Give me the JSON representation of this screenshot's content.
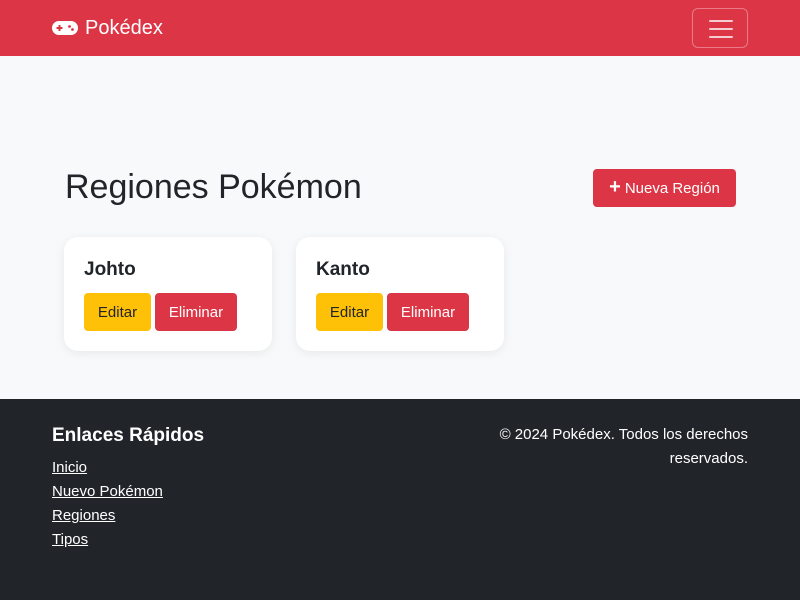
{
  "navbar": {
    "brand": "Pokédex",
    "brand_icon": "gamepad-icon",
    "toggler_icon": "menu-icon"
  },
  "main": {
    "title": "Regiones Pokémon",
    "new_button": {
      "icon": "plus-icon",
      "label": "Nueva Región"
    },
    "regions": [
      {
        "name": "Johto",
        "edit_label": "Editar",
        "delete_label": "Eliminar"
      },
      {
        "name": "Kanto",
        "edit_label": "Editar",
        "delete_label": "Eliminar"
      }
    ]
  },
  "footer": {
    "heading": "Enlaces Rápidos",
    "links": [
      "Inicio",
      "Nuevo Pokémon",
      "Regiones",
      "Tipos"
    ],
    "copyright_line1": "© 2024 Pokédex. Todos los derechos",
    "copyright_line2": "reservados."
  },
  "colors": {
    "primary": "#dc3545",
    "warning": "#ffc107",
    "dark": "#212529",
    "light": "#f8f9fa"
  }
}
